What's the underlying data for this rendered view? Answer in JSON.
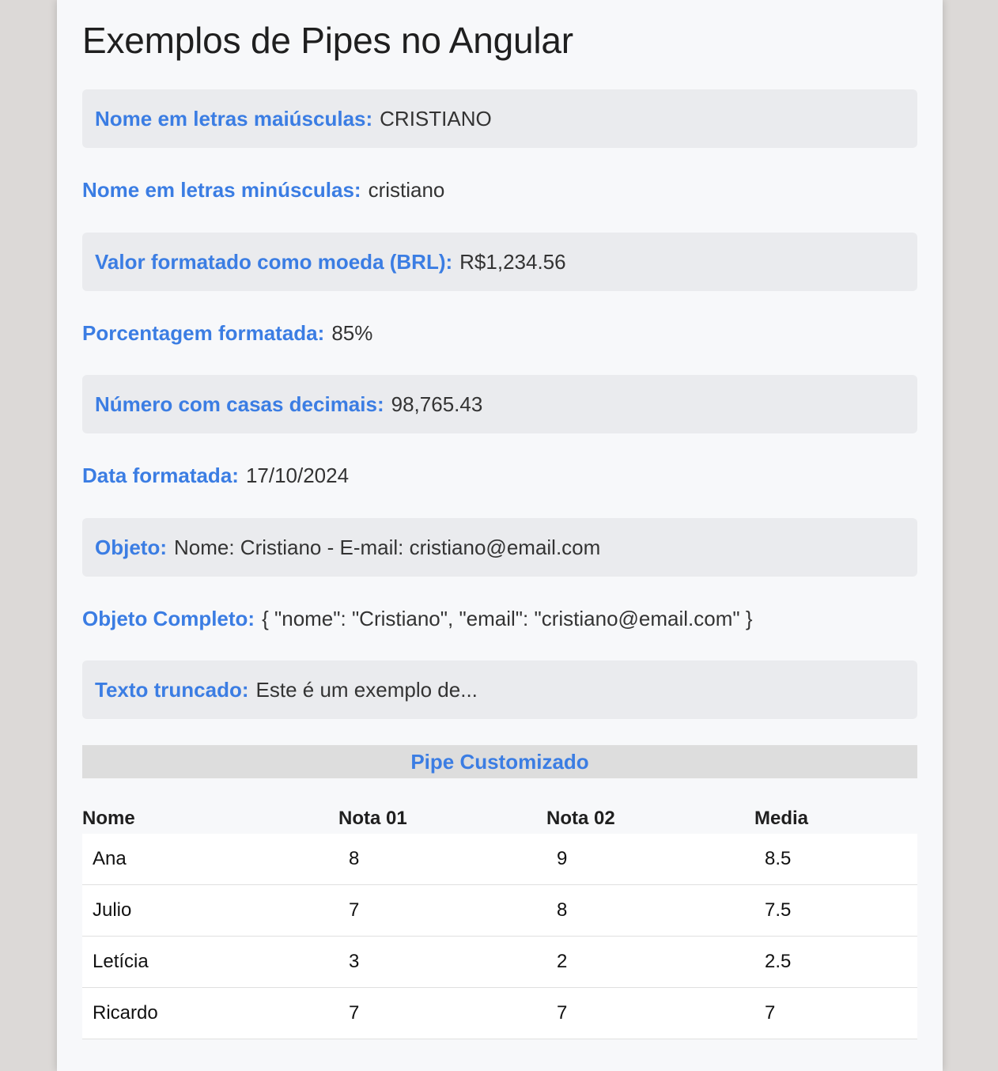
{
  "page": {
    "title": "Exemplos de Pipes no Angular"
  },
  "items": [
    {
      "label": "Nome em letras maiúsculas:",
      "value": "CRISTIANO"
    },
    {
      "label": "Nome em letras minúsculas:",
      "value": "cristiano"
    },
    {
      "label": "Valor formatado como moeda (BRL):",
      "value": "R$1,234.56"
    },
    {
      "label": "Porcentagem formatada:",
      "value": "85%"
    },
    {
      "label": "Número com casas decimais:",
      "value": "98,765.43"
    },
    {
      "label": "Data formatada:",
      "value": "17/10/2024"
    },
    {
      "label": "Objeto:",
      "value": "Nome: Cristiano - E-mail: cristiano@email.com"
    },
    {
      "label": "Objeto Completo:",
      "value": "{ \"nome\": \"Cristiano\", \"email\": \"cristiano@email.com\" }"
    },
    {
      "label": "Texto truncado:",
      "value": "Este é um exemplo de..."
    }
  ],
  "custom_pipe": {
    "title": "Pipe Customizado",
    "headers": [
      "Nome",
      "Nota 01",
      "Nota 02",
      "Media"
    ],
    "rows": [
      [
        "Ana",
        "8",
        "9",
        "8.5"
      ],
      [
        "Julio",
        "7",
        "8",
        "7.5"
      ],
      [
        "Letícia",
        "3",
        "2",
        "2.5"
      ],
      [
        "Ricardo",
        "7",
        "7",
        "7"
      ]
    ]
  },
  "colors": {
    "label_blue": "#3b7de3",
    "shaded_row": "#eaebee",
    "section_head_bg": "#dddddd",
    "page_bg": "#f7f8fa"
  }
}
